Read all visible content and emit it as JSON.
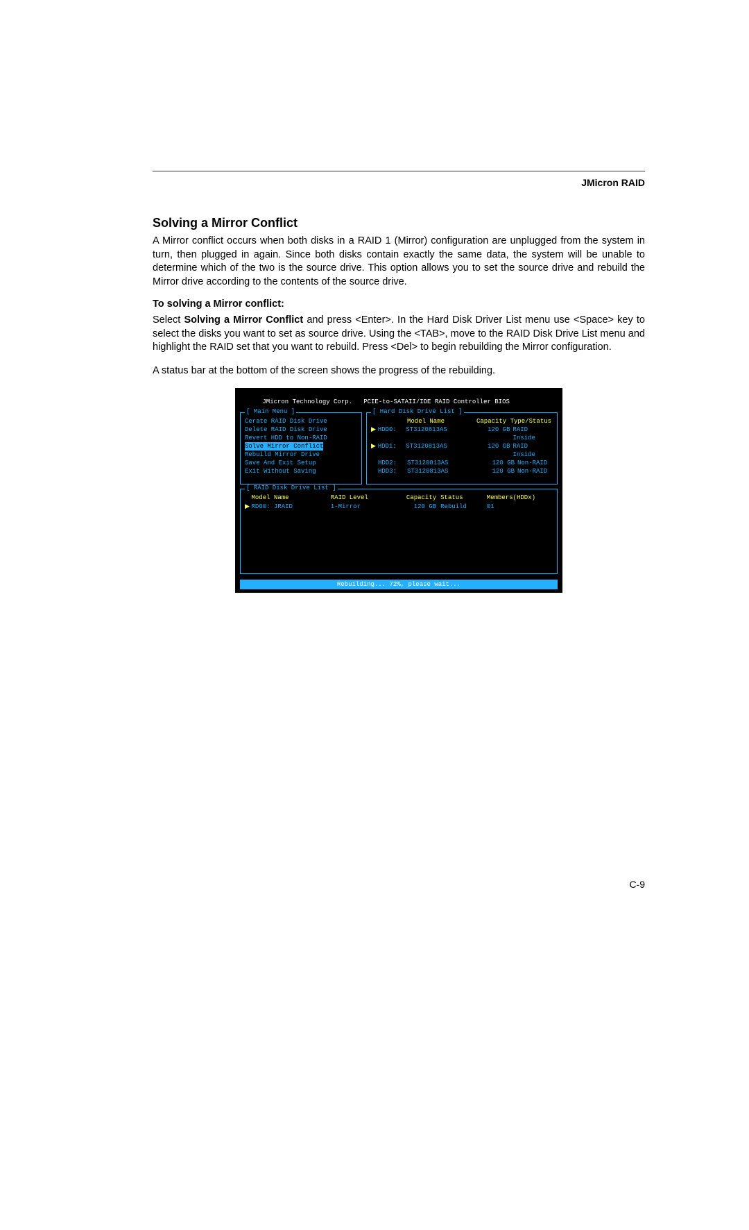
{
  "header": {
    "title": "JMicron RAID"
  },
  "section": {
    "title": "Solving a Mirror Conflict"
  },
  "para1": "A Mirror conflict occurs when both disks in a RAID 1 (Mirror) configuration are unplugged from the system in turn, then plugged in again. Since both disks contain exactly the same data, the system will be unable to determine which of the two is the source drive. This option allows you to set the source drive and rebuild the Mirror drive according to the contents of the source drive.",
  "subheading": "To solving a Mirror conflict:",
  "para2_prefix": "Select ",
  "para2_bold": "Solving a Mirror Conflict",
  "para2_rest": " and press <Enter>. In the Hard Disk Driver List menu use <Space> key to select the disks you want to set as source drive. Using the <TAB>, move to the RAID Disk Drive List menu and highlight the RAID set that you want to rebuild. Press <Del> to begin rebuilding the Mirror configuration.",
  "para3": "A status bar at the bottom of the screen shows the progress of the rebuilding.",
  "bios": {
    "vendor": "JMicron Technology Corp.",
    "controller": "PCIE-to-SATAII/IDE RAID Controller BIOS",
    "main_menu_title": "[ Main Menu ]",
    "main_menu": [
      "Cerate RAID Disk Drive",
      "Delete RAID Disk Drive",
      "Revert HDD to Non-RAID",
      "Solve Mirror Conflict",
      "Rebuild Mirror Drive",
      "Save And Exit Setup",
      "Exit Without Saving"
    ],
    "main_menu_selected_index": 3,
    "hdd_panel_title": "[ Hard Disk Drive List ]",
    "hdd_headers": {
      "model": "Model Name",
      "capstatus": "Capacity Type/Status"
    },
    "hdds": [
      {
        "mark": "▶",
        "id": "HDD0:",
        "model": "ST3120813AS",
        "cap": "120 GB",
        "status": "RAID Inside"
      },
      {
        "mark": "▶",
        "id": "HDD1:",
        "model": "ST3120813AS",
        "cap": "120 GB",
        "status": "RAID Inside"
      },
      {
        "mark": "",
        "id": "HDD2:",
        "model": "ST3120813AS",
        "cap": "120 GB",
        "status": "Non-RAID"
      },
      {
        "mark": "",
        "id": "HDD3:",
        "model": "ST3120813AS",
        "cap": "120 GB",
        "status": "Non-RAID"
      }
    ],
    "raid_panel_title": "[ RAID Disk Drive List ]",
    "raid_headers": {
      "model": "Model Name",
      "level": "RAID Level",
      "cap": "Capacity",
      "status": "Status",
      "members": "Members(HDDx)"
    },
    "raid_rows": [
      {
        "mark": "▶",
        "model": "RD00: JRAID",
        "level": "1-Mirror",
        "cap": "120 GB",
        "status": "Rebuild",
        "members": "01"
      }
    ],
    "status_bar": "Rebuilding... 72%, please wait..."
  },
  "page_number": "C-9"
}
